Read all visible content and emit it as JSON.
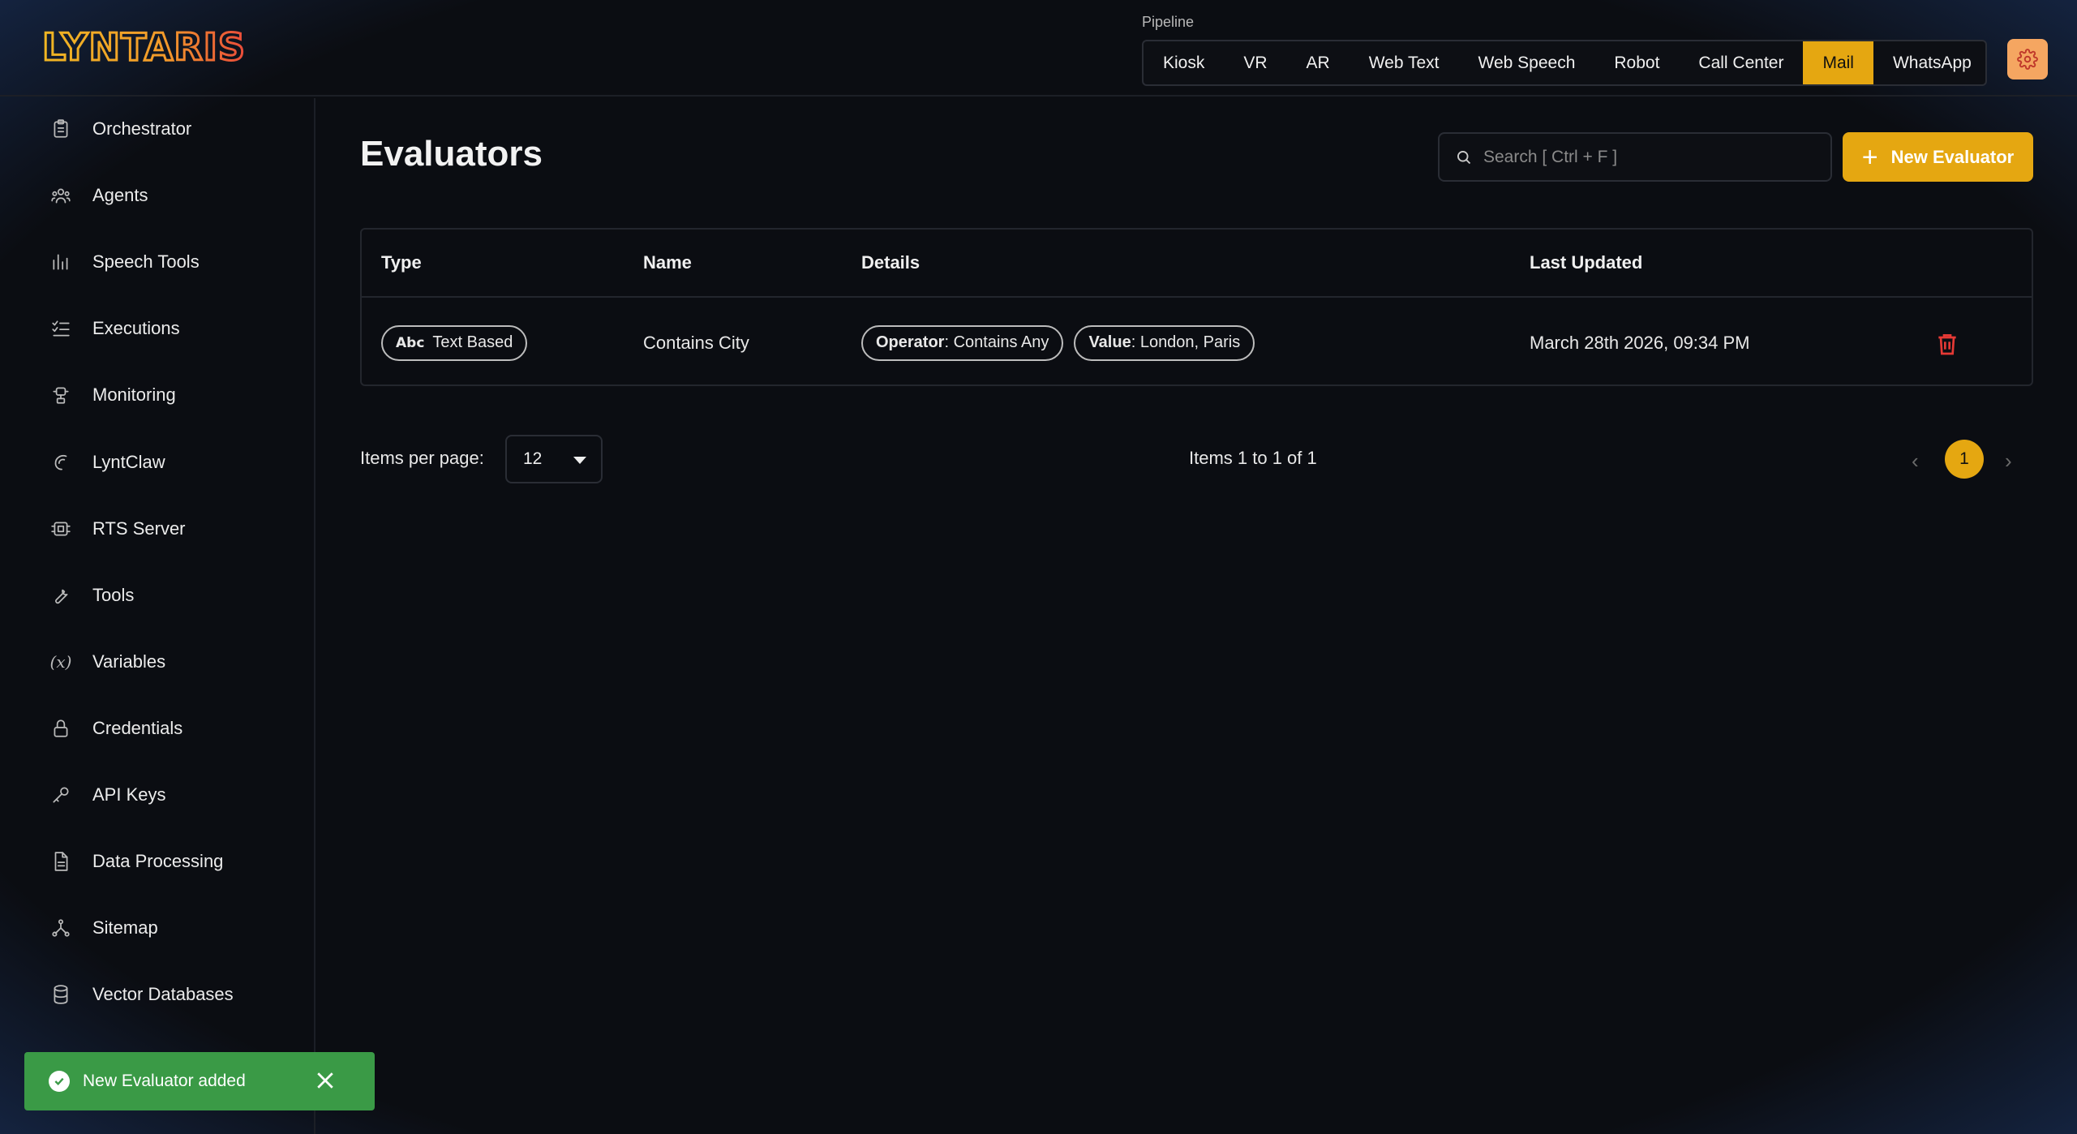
{
  "app": {
    "logo_text": "LYNTARIS"
  },
  "pipeline": {
    "label": "Pipeline",
    "tabs": [
      {
        "label": "Kiosk",
        "active": false
      },
      {
        "label": "VR",
        "active": false
      },
      {
        "label": "AR",
        "active": false
      },
      {
        "label": "Web Text",
        "active": false
      },
      {
        "label": "Web Speech",
        "active": false
      },
      {
        "label": "Robot",
        "active": false
      },
      {
        "label": "Call Center",
        "active": false
      },
      {
        "label": "Mail",
        "active": true
      },
      {
        "label": "WhatsApp",
        "active": false
      }
    ]
  },
  "sidebar": {
    "items": [
      {
        "label": "Orchestrator",
        "icon": "clipboard-icon"
      },
      {
        "label": "Agents",
        "icon": "users-icon"
      },
      {
        "label": "Speech Tools",
        "icon": "bar-chart-icon"
      },
      {
        "label": "Executions",
        "icon": "list-check-icon"
      },
      {
        "label": "Monitoring",
        "icon": "robot-icon"
      },
      {
        "label": "LyntClaw",
        "icon": "claw-icon"
      },
      {
        "label": "RTS Server",
        "icon": "server-icon"
      },
      {
        "label": "Tools",
        "icon": "wrench-icon"
      },
      {
        "label": "Variables",
        "icon": "variable-icon"
      },
      {
        "label": "Credentials",
        "icon": "lock-icon"
      },
      {
        "label": "API Keys",
        "icon": "key-icon"
      },
      {
        "label": "Data Processing",
        "icon": "document-icon"
      },
      {
        "label": "Sitemap",
        "icon": "sitemap-icon"
      },
      {
        "label": "Vector Databases",
        "icon": "database-icon"
      }
    ]
  },
  "main": {
    "title": "Evaluators",
    "search_placeholder": "Search [ Ctrl + F ]",
    "new_button_label": "New Evaluator",
    "table": {
      "headers": {
        "type": "Type",
        "name": "Name",
        "details": "Details",
        "last_updated": "Last Updated"
      },
      "rows": [
        {
          "type_label": "Text Based",
          "type_icon": "Abc",
          "name": "Contains City",
          "operator_key": "Operator",
          "operator_value": ": Contains Any",
          "value_key": "Value",
          "value_value": ": London, Paris",
          "last_updated": "March 28th 2026, 09:34 PM"
        }
      ]
    },
    "pagination": {
      "items_per_page_label": "Items per page:",
      "items_per_page": "12",
      "items_count": "Items 1 to 1 of 1",
      "current_page": "1"
    }
  },
  "toast": {
    "message": "New Evaluator added"
  },
  "colors": {
    "accent": "#e5a711",
    "success": "#3a9a46",
    "danger": "#e53935",
    "settings": "#f5a661"
  }
}
